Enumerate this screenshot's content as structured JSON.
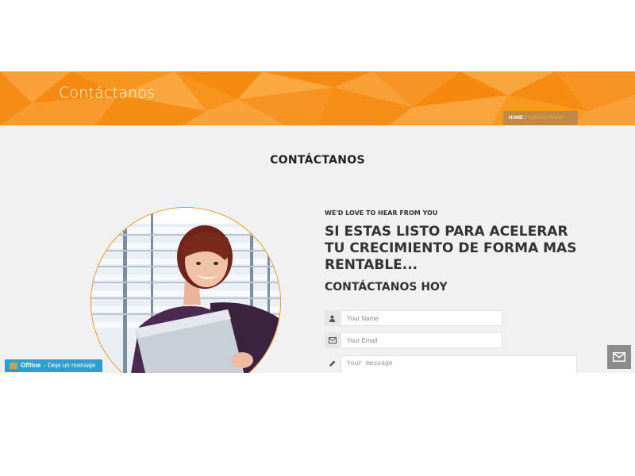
{
  "banner": {
    "title": "Contáctanos",
    "breadcrumb": {
      "home": "HOME",
      "separator": "/",
      "current": "CONTÁCTANOS"
    }
  },
  "section": {
    "title": "CONTÁCTANOS"
  },
  "intro": {
    "eyebrow": "WE'D LOVE TO HEAR FROM YOU",
    "headline": "SI ESTAS LISTO PARA ACELERAR TU CRECIMIENTO DE FORMA MAS RENTABLE...",
    "subheadline": "CONTÁCTANOS HOY"
  },
  "form": {
    "name_placeholder": "Your Name",
    "email_placeholder": "Your Email",
    "message_placeholder": "Your message"
  },
  "chat": {
    "status": "Offline",
    "message": "- Deje un mensaje"
  },
  "colors": {
    "accent": "#f7941d",
    "chat": "#2a9fd6",
    "mail_button": "#8c8c8c"
  },
  "icons": {
    "name": "user-icon",
    "email": "envelope-icon",
    "message": "pencil-icon",
    "floating": "envelope-icon"
  }
}
